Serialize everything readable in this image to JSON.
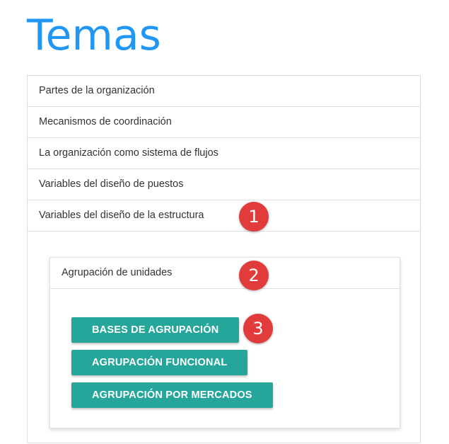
{
  "page": {
    "title": "Temas"
  },
  "topics": [
    {
      "label": "Partes de la organización"
    },
    {
      "label": "Mecanismos de coordinación"
    },
    {
      "label": "La organización como sistema de flujos"
    },
    {
      "label": "Variables del diseño de puestos"
    },
    {
      "label": "Variables del diseño de la estructura"
    }
  ],
  "subsection": {
    "header": "Agrupación de unidades",
    "buttons": [
      {
        "label": "Bases de agrupación"
      },
      {
        "label": "Agrupación funcional"
      },
      {
        "label": "Agrupación por mercados"
      }
    ]
  },
  "markers": [
    "1",
    "2",
    "3"
  ],
  "colors": {
    "title": "#2196f3",
    "button": "#26a69a",
    "marker": "#e23b3b"
  }
}
